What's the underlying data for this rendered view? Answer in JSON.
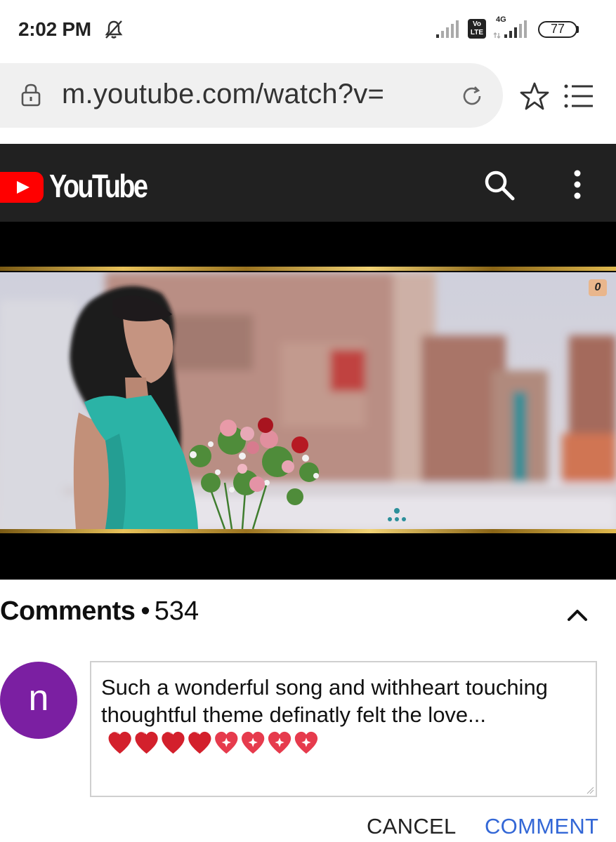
{
  "status_bar": {
    "time": "2:02 PM",
    "network_type": "4G",
    "volte_label": "Vo\nLTE",
    "battery": "77"
  },
  "browser": {
    "url": "m.youtube.com/watch?v="
  },
  "youtube": {
    "wordmark": "YouTube",
    "brand_color": "#ff0000"
  },
  "video": {
    "corner_badge": "0"
  },
  "comments": {
    "label": "Comments",
    "separator": "•",
    "count": "534",
    "avatar_letter": "n",
    "avatar_color": "#7b1fa2",
    "draft_text": "Such a wonderful song and withheart touching thoughtful theme definatly felt the love...",
    "emojis": [
      "red-heart",
      "red-heart",
      "red-heart",
      "red-heart",
      "sparkling-heart",
      "sparkling-heart",
      "sparkling-heart",
      "sparkling-heart"
    ],
    "cancel_label": "CANCEL",
    "submit_label": "COMMENT"
  }
}
